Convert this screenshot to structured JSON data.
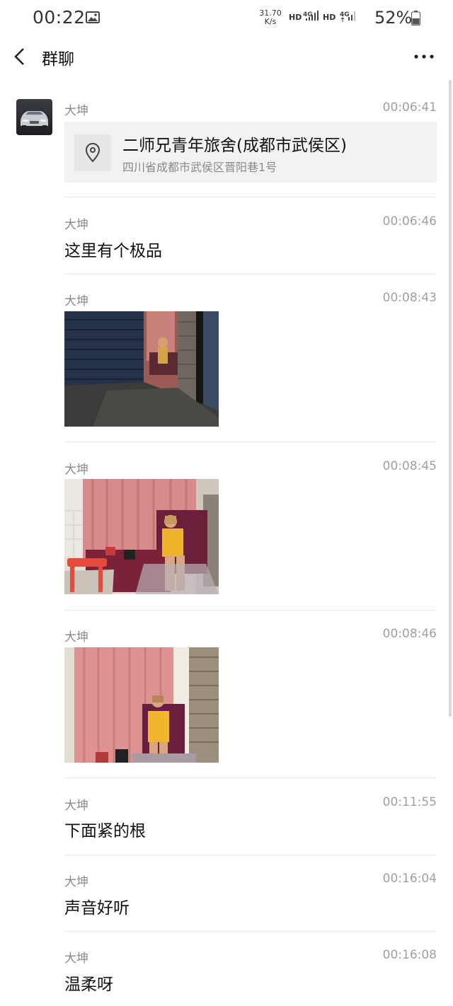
{
  "status_bar": {
    "time": "00:22",
    "net_speed_value": "31.70",
    "net_speed_unit": "K/s",
    "hd_label": "HD",
    "network_type": "4G",
    "battery": "52%"
  },
  "header": {
    "title": "群聊"
  },
  "messages": [
    {
      "sender": "大坤",
      "time": "00:06:41",
      "type": "location",
      "location_name": "二师兄青年旅舍(成都市武侯区)",
      "location_address": "四川省成都市武侯区晋阳巷1号"
    },
    {
      "sender": "大坤",
      "time": "00:06:46",
      "type": "text",
      "text": "这里有个极品"
    },
    {
      "sender": "大坤",
      "time": "00:08:43",
      "type": "image"
    },
    {
      "sender": "大坤",
      "time": "00:08:45",
      "type": "image"
    },
    {
      "sender": "大坤",
      "time": "00:08:46",
      "type": "image"
    },
    {
      "sender": "大坤",
      "time": "00:11:55",
      "type": "text",
      "text": "下面紧的根"
    },
    {
      "sender": "大坤",
      "time": "00:16:04",
      "type": "text",
      "text": "声音好听"
    },
    {
      "sender": "大坤",
      "time": "00:16:08",
      "type": "text",
      "text": "温柔呀"
    }
  ]
}
